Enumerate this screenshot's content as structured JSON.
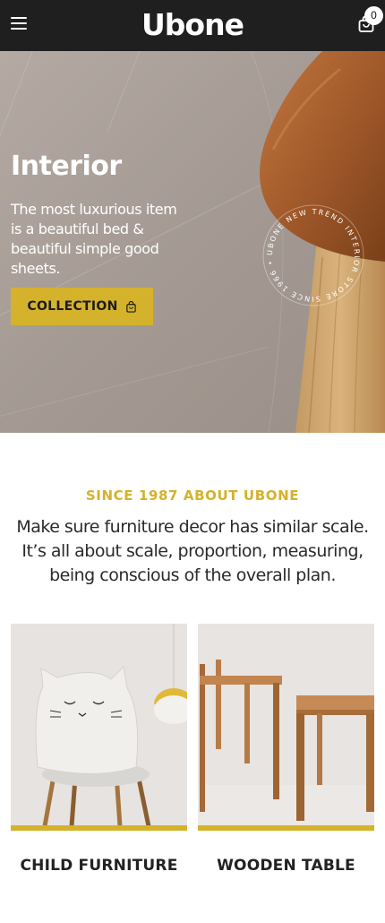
{
  "header": {
    "logo": "Ubone",
    "cart_count": "0",
    "menu_icon": "hamburger-icon",
    "cart_icon": "shopping-bag-icon"
  },
  "hero": {
    "title": "Interior",
    "text": "The most luxurious item is a beautiful bed & beautiful simple good sheets.",
    "button_label": "COLLECTION",
    "button_icon": "shopping-bag-icon",
    "badge_text": "UBONE NEW TREND INTERIOR STORE SINCE 1966 •"
  },
  "about": {
    "eyebrow": "SINCE 1987 ABOUT UBONE",
    "text": "Make sure furniture decor has similar scale. It’s all about scale, proportion, measuring, being conscious of the overall plan."
  },
  "products": [
    {
      "label": "CHILD FURNITURE"
    },
    {
      "label": "WOODEN TABLE"
    }
  ],
  "colors": {
    "header_bg": "#1f1f1f",
    "accent": "#d4b22b",
    "hero_bg": "#a89e97"
  }
}
